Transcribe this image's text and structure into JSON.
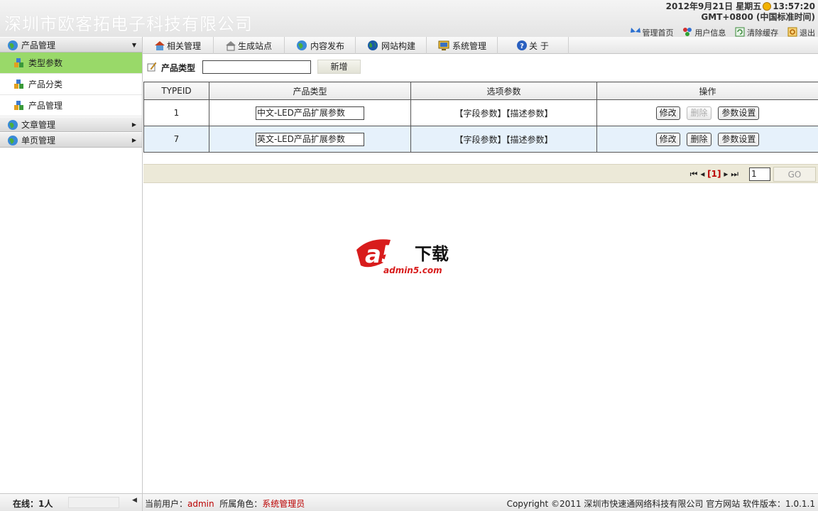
{
  "header": {
    "site_title": "深圳市欧客拓电子科技有限公司",
    "date": "2012年9月21日 星期五",
    "time": "13:57:20",
    "timezone": "GMT+0800 (中国标准时间)",
    "quick_links": [
      "管理首页",
      "用户信息",
      "清除缓存",
      "退出"
    ]
  },
  "sidebar": {
    "groups": [
      {
        "label": "产品管理",
        "arrow": "▼",
        "items": [
          "类型参数",
          "产品分类",
          "产品管理"
        ]
      },
      {
        "label": "文章管理",
        "arrow": "▶"
      },
      {
        "label": "单页管理",
        "arrow": "▶"
      }
    ]
  },
  "nav": {
    "tabs": [
      "相关管理",
      "生成站点",
      "内容发布",
      "网站构建",
      "系统管理",
      "关 于"
    ]
  },
  "toolbar": {
    "label": "产品类型",
    "input_value": "",
    "add_label": "新增"
  },
  "table": {
    "headers": [
      "TYPEID",
      "产品类型",
      "选项参数",
      "操作"
    ],
    "rows": [
      {
        "id": "1",
        "type": "中文-LED产品扩展参数",
        "options": "【字段参数】【描述参数】",
        "edit": "修改",
        "delete": "删除",
        "settings": "参数设置"
      },
      {
        "id": "7",
        "type": "英文-LED产品扩展参数",
        "options": "【字段参数】【描述参数】",
        "edit": "修改",
        "delete": "删除",
        "settings": "参数设置"
      }
    ]
  },
  "pager": {
    "current": "[1]",
    "page_value": "1",
    "go_label": "GO"
  },
  "watermark": {
    "brand": "a5",
    "slogan": "下载",
    "site": "admin5.com"
  },
  "footer": {
    "online": "在线：1人",
    "user_label": "当前用户：",
    "user": "admin",
    "role_label": "所属角色：",
    "role": "系统管理员",
    "copyright": "Copyright ©2011 深圳市快速通网络科技有限公司 官方网站 软件版本：1.0.1.1"
  },
  "colors": {
    "active_item": "#99d969",
    "alt_row": "#e6f1fb",
    "pager_bg": "#ece9d8",
    "accent_red": "#bb0000"
  }
}
